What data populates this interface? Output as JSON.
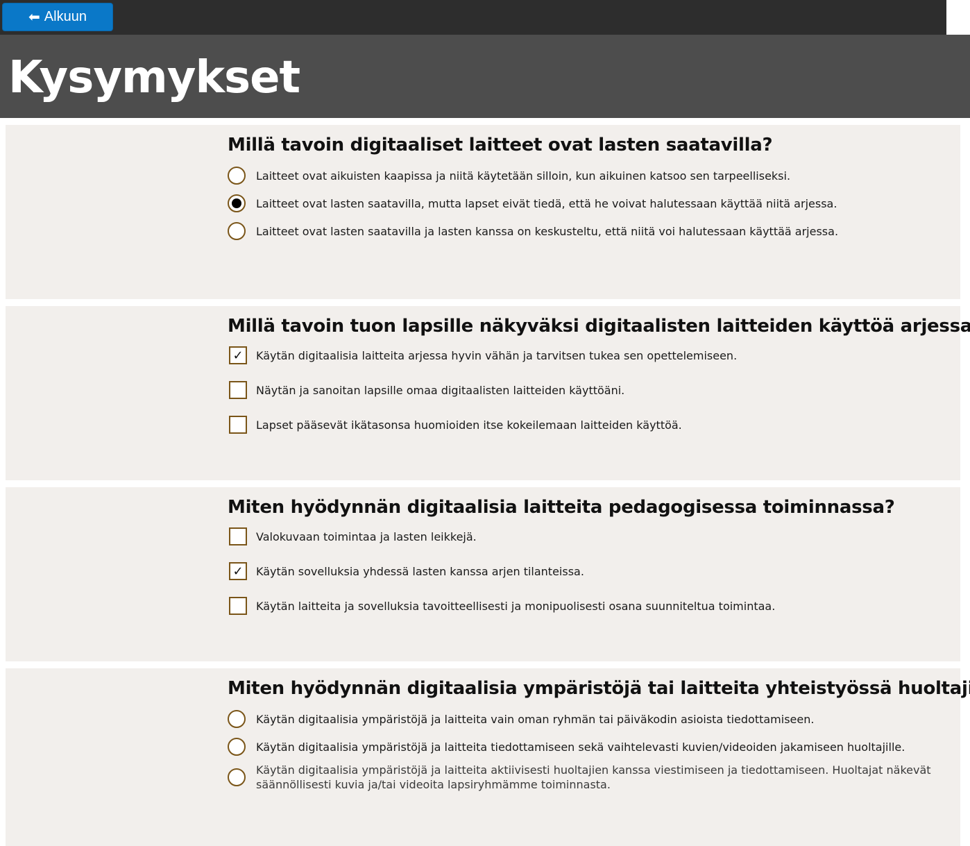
{
  "header": {
    "back_label": "Alkuun",
    "title": "Kysymykset"
  },
  "questions": [
    {
      "title": "Millä tavoin digitaaliset laitteet ovat lasten saatavilla?",
      "type": "radio",
      "options": [
        {
          "label": "Laitteet ovat aikuisten kaapissa ja niitä käytetään silloin, kun aikuinen katsoo sen tarpeelliseksi.",
          "selected": false
        },
        {
          "label": "Laitteet ovat lasten saatavilla, mutta lapset eivät tiedä, että he voivat halutessaan käyttää niitä arjessa.",
          "selected": true
        },
        {
          "label": "Laitteet ovat lasten saatavilla ja lasten kanssa on keskusteltu, että niitä voi halutessaan käyttää arjessa.",
          "selected": false
        }
      ]
    },
    {
      "title": "Millä tavoin tuon lapsille näkyväksi digitaalisten laitteiden käyttöä arjessa?",
      "type": "checkbox",
      "options": [
        {
          "label": "Käytän digitaalisia laitteita arjessa hyvin vähän ja tarvitsen tukea sen opettelemiseen.",
          "checked": true
        },
        {
          "label": "Näytän ja sanoitan lapsille omaa digitaalisten laitteiden käyttöäni.",
          "checked": false
        },
        {
          "label": "Lapset pääsevät ikätasonsa huomioiden itse kokeilemaan laitteiden käyttöä.",
          "checked": false
        }
      ]
    },
    {
      "title": "Miten hyödynnän digitaalisia laitteita pedagogisessa toiminnassa?",
      "type": "checkbox",
      "options": [
        {
          "label": "Valokuvaan toimintaa ja lasten leikkejä.",
          "checked": false
        },
        {
          "label": "Käytän sovelluksia yhdessä lasten kanssa arjen tilanteissa.",
          "checked": true
        },
        {
          "label": "Käytän laitteita ja sovelluksia tavoitteellisesti ja monipuolisesti osana suunniteltua toimintaa.",
          "checked": false
        }
      ]
    },
    {
      "title": "Miten hyödynnän digitaalisia ympäristöjä tai laitteita yhteistyössä huoltajien",
      "type": "radio",
      "options": [
        {
          "label": "Käytän digitaalisia ympäristöjä ja laitteita vain oman ryhmän tai päiväkodin asioista tiedottamiseen.",
          "selected": false
        },
        {
          "label": "Käytän digitaalisia ympäristöjä ja laitteita tiedottamiseen sekä vaihtelevasti kuvien/videoiden jakamiseen huoltajille.",
          "selected": false
        },
        {
          "label": "Käytän digitaalisia ympäristöjä ja laitteita aktiivisesti huoltajien kanssa viestimiseen ja tiedottamiseen. Huoltajat näkevät säännöllisesti kuvia ja/tai videoita lapsiryhmämme toiminnasta.",
          "selected": false
        }
      ]
    }
  ],
  "colors": {
    "topbar": "#2d2d2d",
    "hero": "#4d4d4d",
    "card": "#f2efec",
    "button": "#0a78c8",
    "control_border": "#7a5518"
  }
}
